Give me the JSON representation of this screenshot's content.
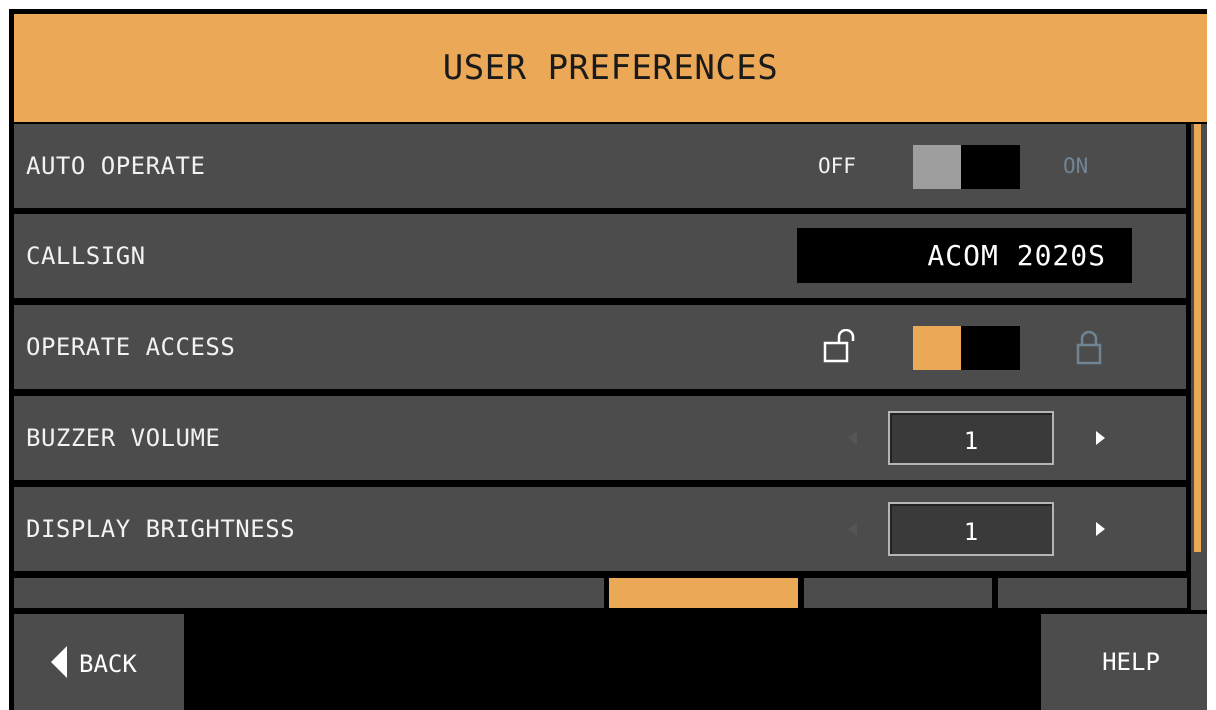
{
  "title": "USER PREFERENCES",
  "colors": {
    "accent": "#eba857",
    "row_bg": "#4c4c4c",
    "screen_bg": "#000000",
    "toggle_off_knob": "#9e9e9e",
    "inactive_label": "#6f8594"
  },
  "rows": {
    "auto_operate": {
      "label": "AUTO OPERATE",
      "off_label": "OFF",
      "on_label": "ON",
      "state": "off"
    },
    "callsign": {
      "label": "CALLSIGN",
      "value": "ACOM 2020S"
    },
    "operate_access": {
      "label": "OPERATE ACCESS",
      "left_icon": "unlock-icon",
      "right_icon": "lock-icon",
      "state": "unlocked"
    },
    "buzzer_volume": {
      "label": "BUZZER VOLUME",
      "value": "1"
    },
    "display_brightness": {
      "label": "DISPLAY BRIGHTNESS",
      "value": "1"
    }
  },
  "pagination": {
    "pages": 4,
    "current_page": 2
  },
  "footer": {
    "back_label": "BACK",
    "help_label": "HELP"
  }
}
